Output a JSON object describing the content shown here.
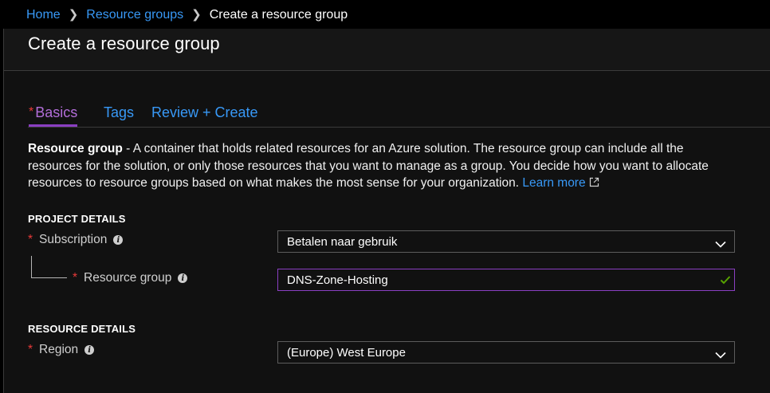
{
  "breadcrumb": {
    "items": [
      "Home",
      "Resource groups"
    ],
    "current": "Create a resource group"
  },
  "page": {
    "title": "Create a resource group"
  },
  "tabs": [
    {
      "label": "Basics",
      "required_marker": "*",
      "active": true
    },
    {
      "label": "Tags",
      "active": false
    },
    {
      "label": "Review + Create",
      "active": false
    }
  ],
  "description": {
    "bold": "Resource group",
    "text": " - A container that holds related resources for an Azure solution. The resource group can include all the resources for the solution, or only those resources that you want to manage as a group. You decide how you want to allocate resources to resource groups based on what makes the most sense for your organization. ",
    "link": "Learn more"
  },
  "project_details": {
    "header": "PROJECT DETAILS",
    "subscription": {
      "required_marker": "*",
      "label": "Subscription",
      "value": "Betalen naar gebruik"
    },
    "resource_group": {
      "required_marker": "*",
      "label": "Resource group",
      "value": "DNS-Zone-Hosting"
    }
  },
  "resource_details": {
    "header": "RESOURCE DETAILS",
    "region": {
      "required_marker": "*",
      "label": "Region",
      "value": "(Europe) West Europe"
    }
  },
  "icons": {
    "breadcrumb_separator": "chevron-right-icon",
    "dropdown": "chevron-down-icon",
    "info": "info-icon",
    "valid": "checkmark-icon",
    "external_link": "external-link-icon"
  },
  "colors": {
    "link": "#3899f7",
    "active_tab": "#b36ed9",
    "required": "#e83a3a",
    "valid": "#57a300",
    "focus_border": "#8a3fc2"
  }
}
